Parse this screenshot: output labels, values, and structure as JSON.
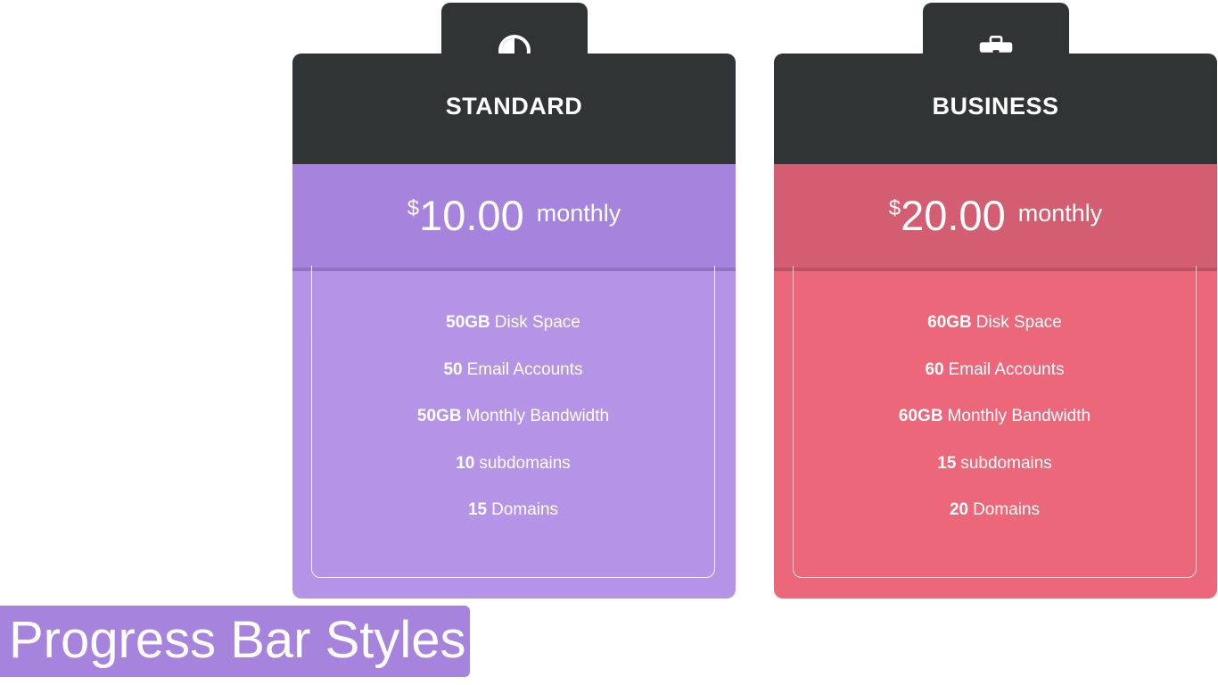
{
  "caption": "Progress Bar Styles",
  "plans": [
    {
      "name": "STANDARD",
      "icon": "half-circle-icon",
      "currency": "$",
      "amount": "10.00",
      "period": "monthly",
      "accent_price": "#a683dc",
      "accent_body": "#b594e7",
      "features": [
        {
          "value": "50GB",
          "label": "Disk Space"
        },
        {
          "value": "50",
          "label": "Email Accounts"
        },
        {
          "value": "50GB",
          "label": "Monthly Bandwidth"
        },
        {
          "value": "10",
          "label": "subdomains"
        },
        {
          "value": "15",
          "label": "Domains"
        }
      ]
    },
    {
      "name": "BUSINESS",
      "icon": "briefcase-icon",
      "currency": "$",
      "amount": "20.00",
      "period": "monthly",
      "accent_price": "#d45e71",
      "accent_body": "#ec6779",
      "features": [
        {
          "value": "60GB",
          "label": "Disk Space"
        },
        {
          "value": "60",
          "label": "Email Accounts"
        },
        {
          "value": "60GB",
          "label": "Monthly Bandwidth"
        },
        {
          "value": "15",
          "label": "subdomains"
        },
        {
          "value": "20",
          "label": "Domains"
        }
      ]
    }
  ],
  "colors": {
    "header": "#313434",
    "caption_bg": "#a683dc",
    "text": "#ffffff"
  }
}
